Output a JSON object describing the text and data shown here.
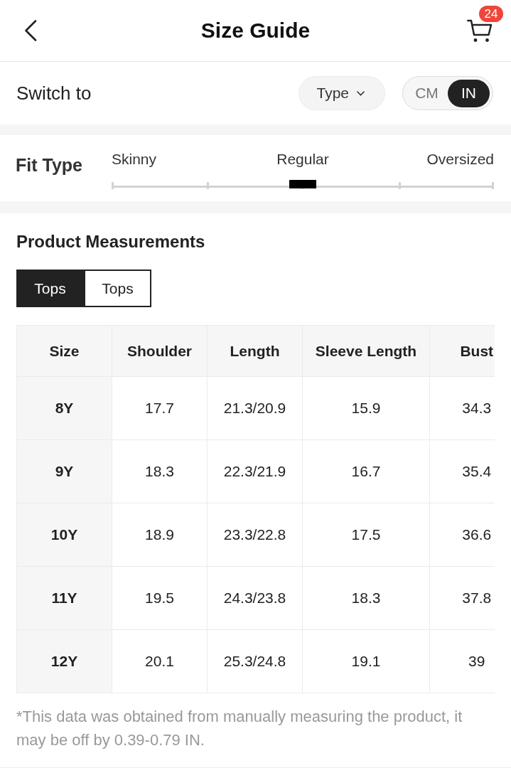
{
  "header": {
    "title": "Size Guide",
    "cart_badge": "24"
  },
  "switch_row": {
    "label": "Switch to",
    "dropdown": {
      "label": "Type"
    },
    "units": [
      {
        "label": "CM",
        "selected": false
      },
      {
        "label": "IN",
        "selected": true
      }
    ]
  },
  "fit_type": {
    "label": "Fit Type",
    "options": [
      "Skinny",
      "Regular",
      "Oversized"
    ],
    "level": 0.5
  },
  "measurements": {
    "title": "Product Measurements",
    "tabs": [
      {
        "label": "Tops",
        "selected": true
      },
      {
        "label": "Tops",
        "selected": false
      }
    ],
    "table": {
      "columns": [
        "Size",
        "Shoulder",
        "Length",
        "Sleeve Length",
        "Bust"
      ],
      "rows": [
        [
          "8Y",
          "17.7",
          "21.3/20.9",
          "15.9",
          "34.3"
        ],
        [
          "9Y",
          "18.3",
          "22.3/21.9",
          "16.7",
          "35.4"
        ],
        [
          "10Y",
          "18.9",
          "23.3/22.8",
          "17.5",
          "36.6"
        ],
        [
          "11Y",
          "19.5",
          "24.3/23.8",
          "18.3",
          "37.8"
        ],
        [
          "12Y",
          "20.1",
          "25.3/24.8",
          "19.1",
          "39"
        ]
      ]
    },
    "footnote": "*This data was obtained from manually measuring the product, it may be off by 0.39-0.79 IN."
  }
}
